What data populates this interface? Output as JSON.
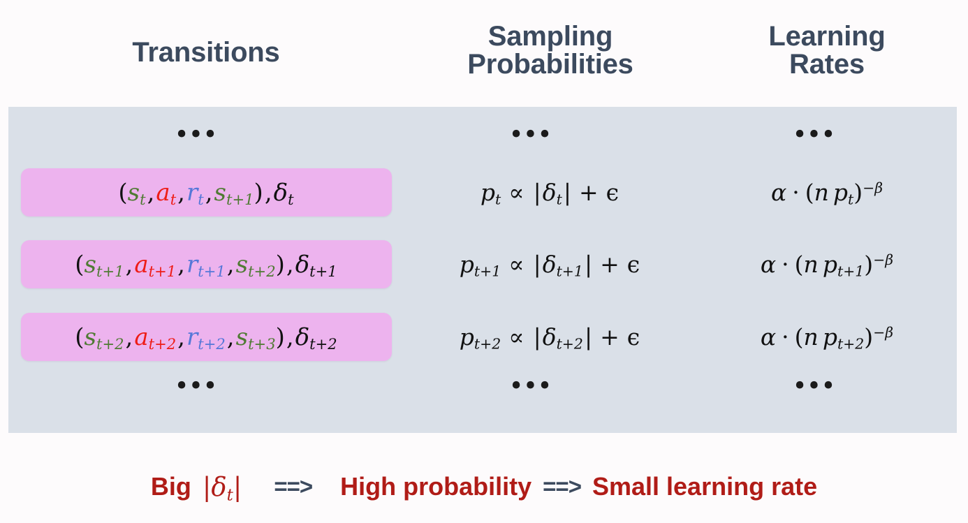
{
  "columns": {
    "transitions": {
      "label": "Transitions"
    },
    "sampling": {
      "line1": "Sampling",
      "line2": "Probabilities"
    },
    "learning": {
      "line1": "Learning",
      "line2": "Rates"
    }
  },
  "ellipsis": {
    "glyph": "•••",
    "top": "•••",
    "bottom": "•••"
  },
  "symbols": {
    "open_paren": "(",
    "close_paren": ")",
    "comma": ",",
    "state": "s",
    "action": "a",
    "reward": "r",
    "delta": "δ",
    "prob": "p",
    "proportional": "∝",
    "abs_bar": "|",
    "plus": "+",
    "epsilon": "ϵ",
    "alpha": "α",
    "cdot": "·",
    "n": "n",
    "minus_beta": "−β"
  },
  "rows": [
    {
      "index": 0,
      "transition": {
        "state": "s",
        "state_sub": "t",
        "action": "a",
        "action_sub": "t",
        "reward": "r",
        "reward_sub": "t",
        "next_state": "s",
        "next_state_sub": "t+1",
        "delta": "δ",
        "delta_sub": "t",
        "text": "(s_t, a_t, r_t, s_{t+1}), δ_t"
      },
      "probability": {
        "p_sub": "t",
        "delta_sub": "t",
        "text": "p_t ∝ |δ_t| + ϵ"
      },
      "learning_rate": {
        "p_sub": "t",
        "exponent": "−β",
        "text": "α · (n p_t)^{−β}"
      }
    },
    {
      "index": 1,
      "transition": {
        "state": "s",
        "state_sub": "t+1",
        "action": "a",
        "action_sub": "t+1",
        "reward": "r",
        "reward_sub": "t+1",
        "next_state": "s",
        "next_state_sub": "t+2",
        "delta": "δ",
        "delta_sub": "t+1",
        "text": "(s_{t+1}, a_{t+1}, r_{t+1}, s_{t+2}), δ_{t+1}"
      },
      "probability": {
        "p_sub": "t+1",
        "delta_sub": "t+1",
        "text": "p_{t+1} ∝ |δ_{t+1}| + ϵ"
      },
      "learning_rate": {
        "p_sub": "t+1",
        "exponent": "−β",
        "text": "α · (n p_{t+1})^{−β}"
      }
    },
    {
      "index": 2,
      "transition": {
        "state": "s",
        "state_sub": "t+2",
        "action": "a",
        "action_sub": "t+2",
        "reward": "r",
        "reward_sub": "t+2",
        "next_state": "s",
        "next_state_sub": "t+3",
        "delta": "δ",
        "delta_sub": "t+2",
        "text": "(s_{t+2}, a_{t+2}, r_{t+2}, s_{t+3}), δ_{t+2}"
      },
      "probability": {
        "p_sub": "t+2",
        "delta_sub": "t+2",
        "text": "p_{t+2} ∝ |δ_{t+2}| + ϵ"
      },
      "learning_rate": {
        "p_sub": "t+2",
        "exponent": "−β",
        "text": "α · (n p_{t+2})^{−β}"
      }
    }
  ],
  "caption": {
    "big_label": "Big",
    "delta_sub": "t",
    "arrow1": "==>",
    "middle": "High probability",
    "arrow2": "==>",
    "end": "Small learning rate"
  },
  "colors": {
    "page_background": "#fdfbfc",
    "panel_background": "#dae0e8",
    "pill_pink": "#edb3ee",
    "header_text": "#3c4a5e",
    "state_green": "#4f7a33",
    "action_red": "#ee1c16",
    "reward_blue": "#5577d8",
    "math_black": "#111111",
    "caption_red": "#b01c17",
    "arrow_slate": "#3c4a5e"
  }
}
